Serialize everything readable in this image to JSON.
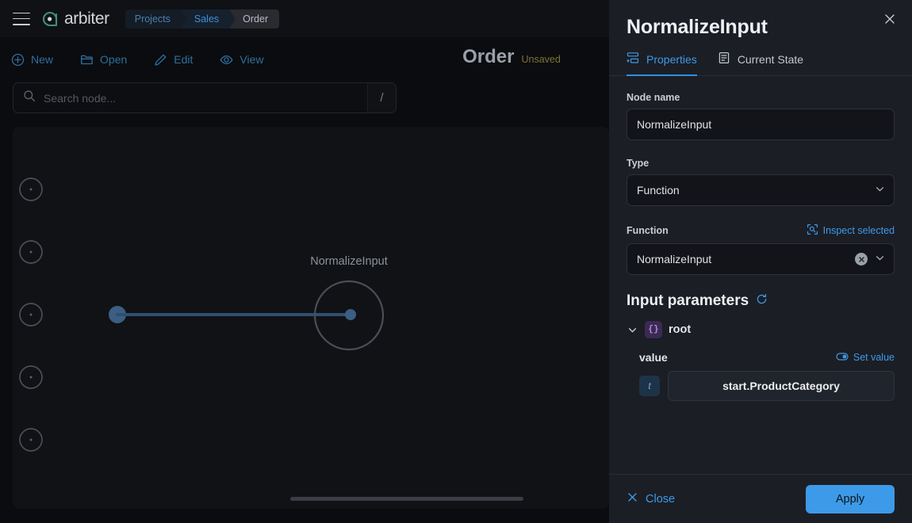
{
  "app": {
    "logo_text": "arbiter",
    "menu_icon": "hamburger-menu-icon",
    "logo_icon": "arbiter-logo-icon"
  },
  "breadcrumb": {
    "items": [
      {
        "label": "Projects"
      },
      {
        "label": "Sales"
      },
      {
        "label": "Order"
      }
    ]
  },
  "document": {
    "title": "Order",
    "status": "Unsaved"
  },
  "toolbar": {
    "items": [
      {
        "label": "New",
        "icon": "plus-circle-icon"
      },
      {
        "label": "Open",
        "icon": "folder-open-icon"
      },
      {
        "label": "Edit",
        "icon": "pencil-icon"
      },
      {
        "label": "View",
        "icon": "eye-icon"
      }
    ]
  },
  "search": {
    "placeholder": "Search node...",
    "value": "",
    "shortcut": "/",
    "icon": "search-icon"
  },
  "canvas": {
    "palette_nodes": [
      {
        "name": "palette-node-1"
      },
      {
        "name": "palette-node-2"
      },
      {
        "name": "palette-node-3"
      },
      {
        "name": "palette-node-4"
      },
      {
        "name": "palette-node-5"
      }
    ],
    "graph_node": {
      "label": "NormalizeInput"
    }
  },
  "panel": {
    "title": "NormalizeInput",
    "close_icon": "close-icon",
    "tabs": [
      {
        "label": "Properties",
        "icon": "properties-icon",
        "active": true
      },
      {
        "label": "Current State",
        "icon": "document-list-icon",
        "active": false
      }
    ],
    "node_name": {
      "label": "Node name",
      "value": "NormalizeInput"
    },
    "type": {
      "label": "Type",
      "value": "Function",
      "icon": "chevron-down-icon"
    },
    "function": {
      "label": "Function",
      "value": "NormalizeInput",
      "inspect_label": "Inspect selected",
      "inspect_icon": "inspect-frame-icon",
      "clear_icon": "clear-x-icon",
      "chevron_icon": "chevron-down-icon"
    },
    "input_parameters": {
      "title": "Input parameters",
      "refresh_icon": "refresh-icon",
      "root": {
        "name": "root",
        "type_badge": "{}",
        "expanded": true
      },
      "params": [
        {
          "name": "value",
          "set_value_label": "Set value",
          "set_value_icon": "eye-toggle-icon",
          "type_badge": "t",
          "value": "start.ProductCategory"
        }
      ]
    },
    "footer": {
      "close_label": "Close",
      "close_icon": "x-icon",
      "apply_label": "Apply"
    }
  },
  "colors": {
    "accent_blue": "#3d9ae8",
    "logo_teal": "#3f8f7a",
    "unsaved_yellow": "#7e7334",
    "panel_bg": "#1b1e25",
    "canvas_bg": "#101216",
    "edge_blue": "#2f4f70",
    "badge_purple": "#b58ce0"
  }
}
